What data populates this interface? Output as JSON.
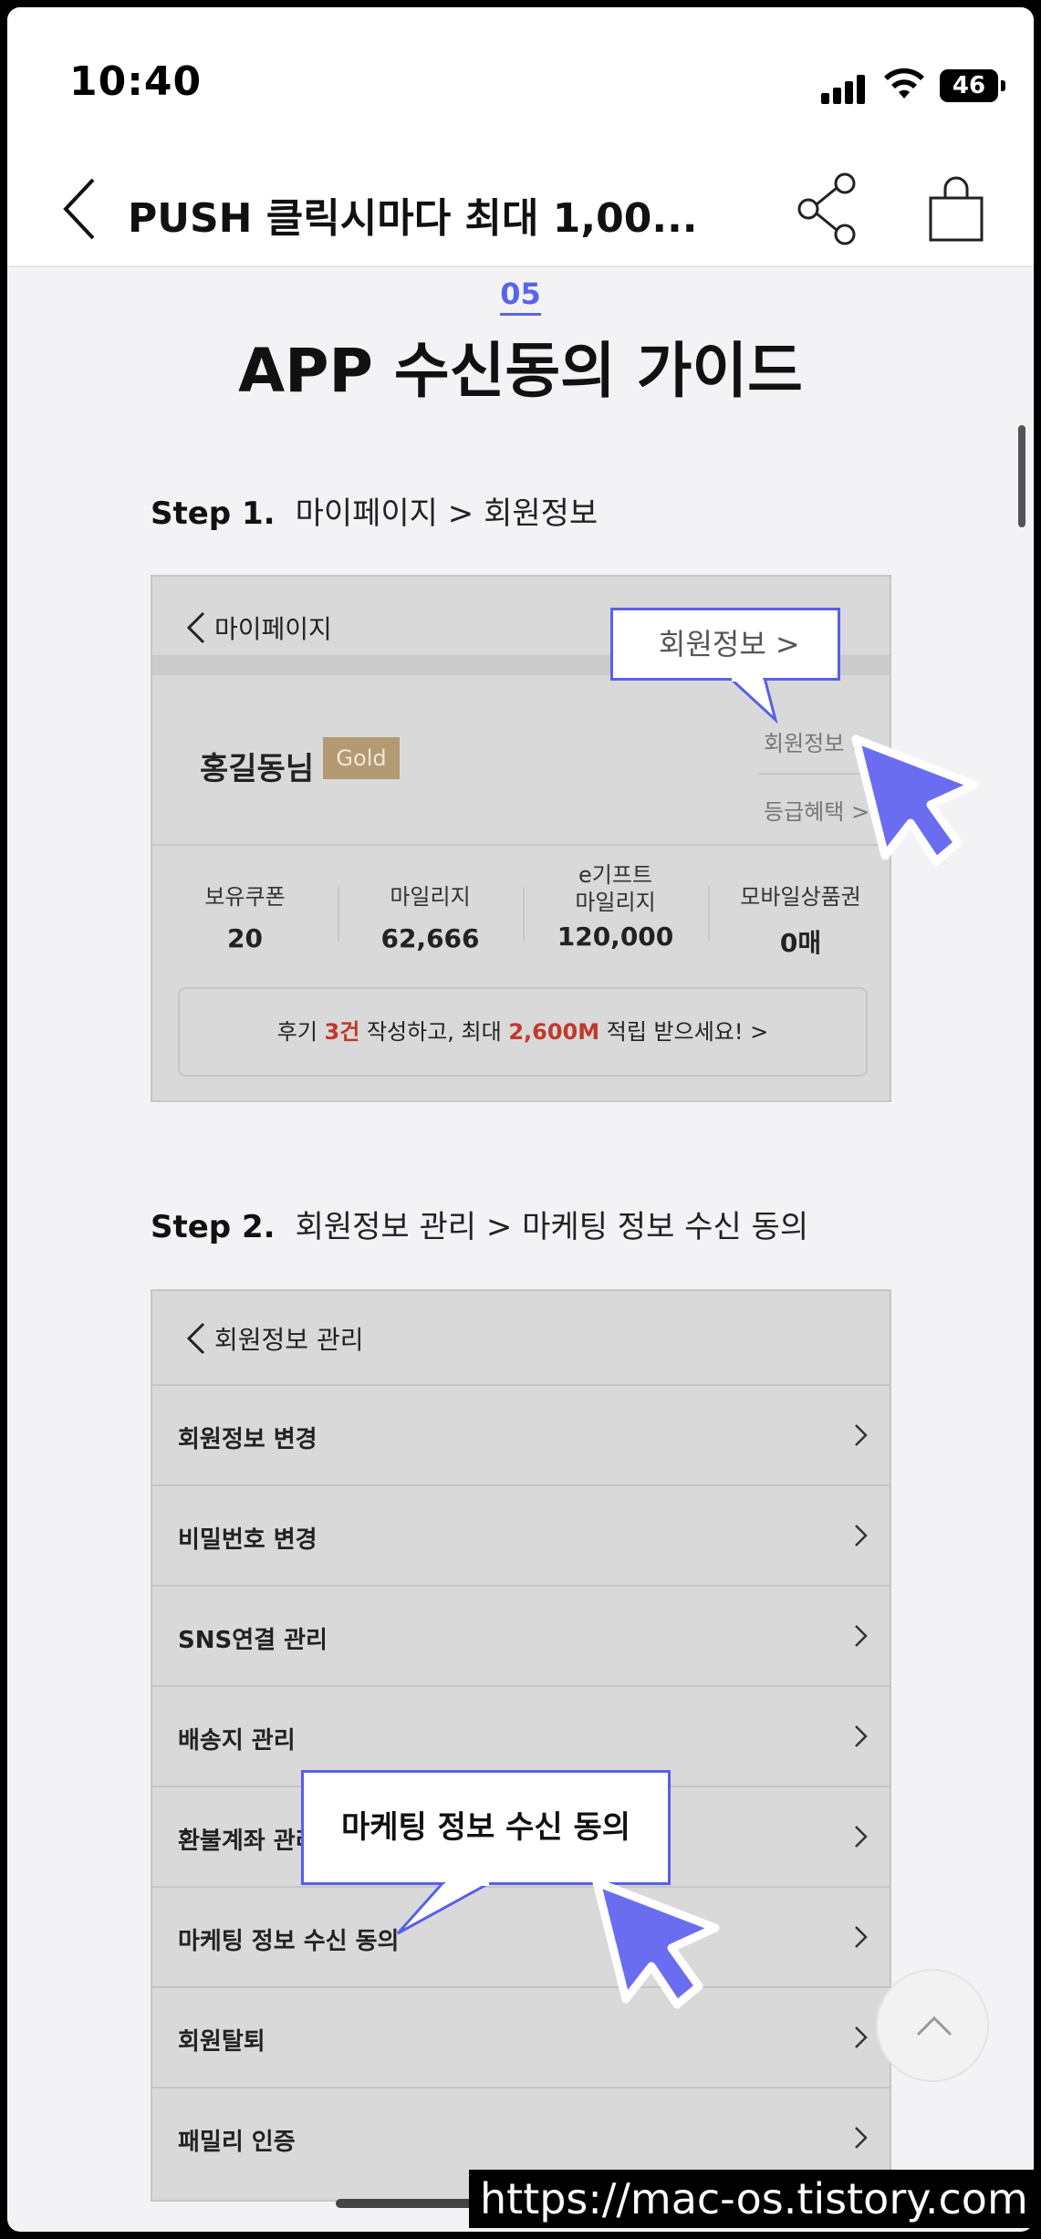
{
  "status_bar": {
    "time": "10:40",
    "battery": "46"
  },
  "nav": {
    "title": "PUSH 클릭시마다 최대 1,00..."
  },
  "guide": {
    "section_number": "05",
    "title": "APP 수신동의 가이드",
    "step1": {
      "label": "Step 1.",
      "path": "마이페이지 > 회원정보"
    },
    "step2": {
      "label": "Step 2.",
      "path": "회원정보 관리 > 마케팅 정보 수신 동의"
    }
  },
  "mock1": {
    "back_title": "마이페이지",
    "user_name": "홍길동님",
    "grade": "Gold",
    "link_member_info": "회원정보 >",
    "link_benefits": "등급혜택 >",
    "stats": [
      {
        "label": "보유쿠폰",
        "value": "20"
      },
      {
        "label": "마일리지",
        "value": "62,666"
      },
      {
        "label": "e기프트\n마일리지",
        "value": "120,000"
      },
      {
        "label": "모바일상품권",
        "value": "0매"
      }
    ],
    "banner": {
      "prefix": "후기 ",
      "count": "3건",
      "mid": " 작성하고, 최대 ",
      "amount": "2,600M",
      "suffix": " 적립 받으세요! >"
    },
    "callout": "회원정보  >"
  },
  "mock2": {
    "back_title": "회원정보 관리",
    "rows": [
      "회원정보 변경",
      "비밀번호 변경",
      "SNS연결 관리",
      "배송지 관리",
      "환불계좌 관리",
      "마케팅 정보 수신 동의",
      "회원탈퇴",
      "패밀리 인증"
    ],
    "callout": "마케팅 정보 수신 동의"
  },
  "watermark": "https://mac-os.tistory.com",
  "colors": {
    "accent": "#5a5fe8",
    "gold": "#b49a72",
    "highlight_red": "#c0392b"
  },
  "icons": [
    "back-chevron-icon",
    "share-icon",
    "shopping-bag-icon",
    "cursor-arrow-icon",
    "scroll-top-icon"
  ]
}
